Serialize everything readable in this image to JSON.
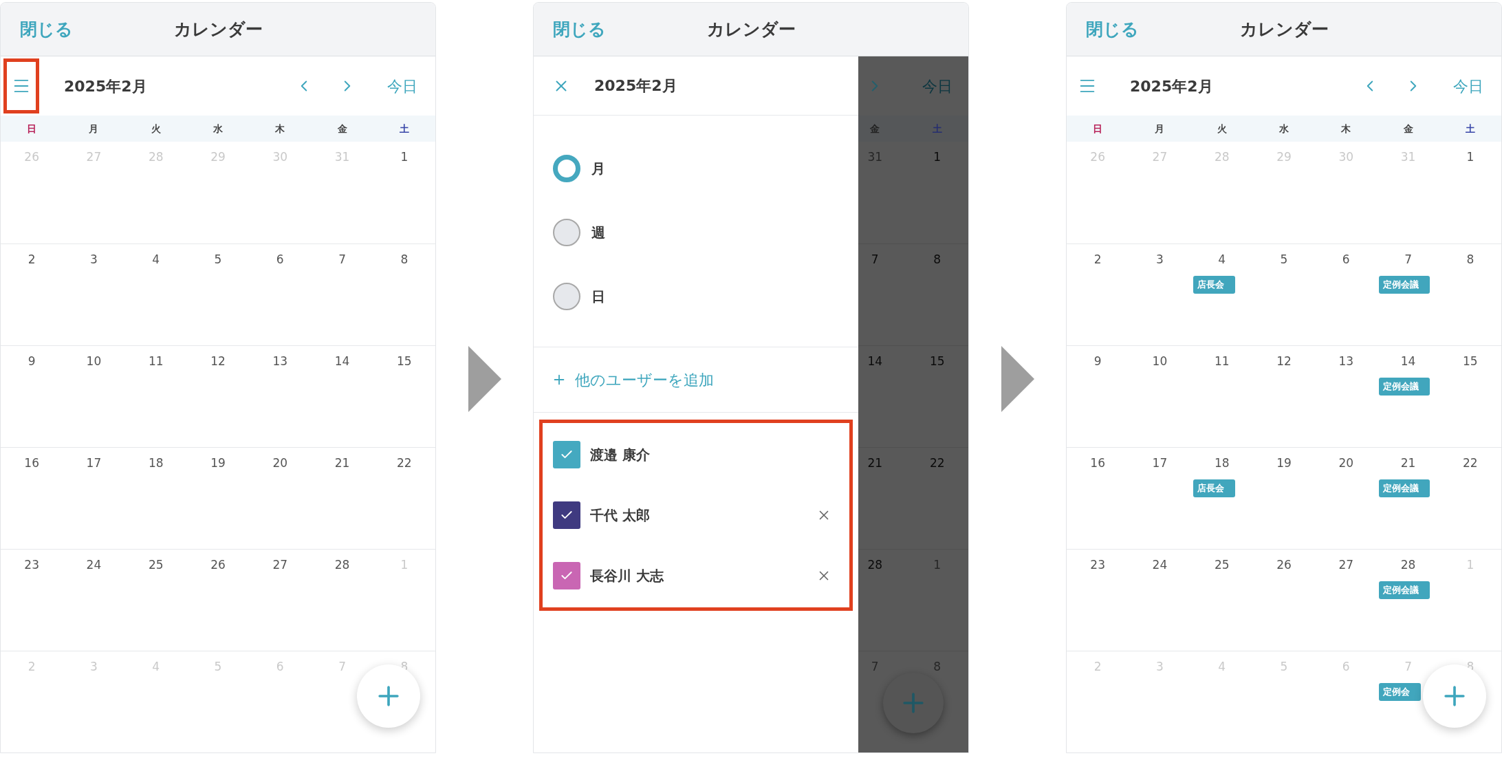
{
  "screens": [
    {
      "kind": "calendar",
      "header": {
        "close": "閉じる",
        "title": "カレンダー"
      },
      "toolbar": {
        "menu_highlighted": true,
        "month": "2025年2月",
        "today": "今日"
      },
      "weekdays": [
        {
          "label": "日",
          "color": "#b8245a"
        },
        {
          "label": "月",
          "color": "#444444"
        },
        {
          "label": "火",
          "color": "#444444"
        },
        {
          "label": "水",
          "color": "#444444"
        },
        {
          "label": "木",
          "color": "#444444"
        },
        {
          "label": "金",
          "color": "#444444"
        },
        {
          "label": "土",
          "color": "#3846a8"
        }
      ],
      "weeks": [
        [
          {
            "day": "26",
            "muted": true
          },
          {
            "day": "27",
            "muted": true
          },
          {
            "day": "28",
            "muted": true
          },
          {
            "day": "29",
            "muted": true
          },
          {
            "day": "30",
            "muted": true
          },
          {
            "day": "31",
            "muted": true
          },
          {
            "day": "1",
            "muted": false
          }
        ],
        [
          {
            "day": "2",
            "muted": false
          },
          {
            "day": "3",
            "muted": false
          },
          {
            "day": "4",
            "muted": false
          },
          {
            "day": "5",
            "muted": false
          },
          {
            "day": "6",
            "muted": false
          },
          {
            "day": "7",
            "muted": false
          },
          {
            "day": "8",
            "muted": false
          }
        ],
        [
          {
            "day": "9",
            "muted": false
          },
          {
            "day": "10",
            "muted": false
          },
          {
            "day": "11",
            "muted": false
          },
          {
            "day": "12",
            "muted": false
          },
          {
            "day": "13",
            "muted": false
          },
          {
            "day": "14",
            "muted": false
          },
          {
            "day": "15",
            "muted": false
          }
        ],
        [
          {
            "day": "16",
            "muted": false
          },
          {
            "day": "17",
            "muted": false
          },
          {
            "day": "18",
            "muted": false
          },
          {
            "day": "19",
            "muted": false
          },
          {
            "day": "20",
            "muted": false
          },
          {
            "day": "21",
            "muted": false
          },
          {
            "day": "22",
            "muted": false
          }
        ],
        [
          {
            "day": "23",
            "muted": false
          },
          {
            "day": "24",
            "muted": false
          },
          {
            "day": "25",
            "muted": false
          },
          {
            "day": "26",
            "muted": false
          },
          {
            "day": "27",
            "muted": false
          },
          {
            "day": "28",
            "muted": false
          },
          {
            "day": "1",
            "muted": true
          }
        ],
        [
          {
            "day": "2",
            "muted": true
          },
          {
            "day": "3",
            "muted": true
          },
          {
            "day": "4",
            "muted": true
          },
          {
            "day": "5",
            "muted": true
          },
          {
            "day": "6",
            "muted": true
          },
          {
            "day": "7",
            "muted": true
          },
          {
            "day": "8",
            "muted": true
          }
        ]
      ]
    },
    {
      "kind": "drawer",
      "header": {
        "close": "閉じる",
        "title": "カレンダー"
      },
      "toolbar": {
        "month": "2025年2月"
      },
      "view_options": [
        {
          "label": "月",
          "selected": true
        },
        {
          "label": "週",
          "selected": false
        },
        {
          "label": "日",
          "selected": false
        }
      ],
      "add_user": "他のユーザーを追加",
      "users_highlighted": true,
      "users": [
        {
          "name": "渡邉 康介",
          "checked": true,
          "color": "#44a9c0",
          "removable": false
        },
        {
          "name": "千代 太郎",
          "checked": true,
          "color": "#3f3a80",
          "removable": true
        },
        {
          "name": "長谷川 大志",
          "checked": true,
          "color": "#c966b3",
          "removable": true
        }
      ],
      "background": {
        "today": "今日",
        "weekdays": [
          {
            "label": "金",
            "color": "#222222"
          },
          {
            "label": "土",
            "color": "#262e70"
          }
        ],
        "weeks": [
          [
            {
              "day": "31",
              "muted": true
            },
            {
              "day": "1",
              "muted": false
            }
          ],
          [
            {
              "day": "7",
              "muted": false
            },
            {
              "day": "8",
              "muted": false
            }
          ],
          [
            {
              "day": "14",
              "muted": false
            },
            {
              "day": "15",
              "muted": false
            }
          ],
          [
            {
              "day": "21",
              "muted": false
            },
            {
              "day": "22",
              "muted": false
            }
          ],
          [
            {
              "day": "28",
              "muted": false
            },
            {
              "day": "1",
              "muted": true
            }
          ],
          [
            {
              "day": "7",
              "muted": true
            },
            {
              "day": "8",
              "muted": true
            }
          ]
        ]
      }
    },
    {
      "kind": "calendar",
      "header": {
        "close": "閉じる",
        "title": "カレンダー"
      },
      "toolbar": {
        "menu_highlighted": false,
        "month": "2025年2月",
        "today": "今日"
      },
      "weekdays": [
        {
          "label": "日",
          "color": "#b8245a"
        },
        {
          "label": "月",
          "color": "#444444"
        },
        {
          "label": "火",
          "color": "#444444"
        },
        {
          "label": "水",
          "color": "#444444"
        },
        {
          "label": "木",
          "color": "#444444"
        },
        {
          "label": "金",
          "color": "#444444"
        },
        {
          "label": "土",
          "color": "#3846a8"
        }
      ],
      "weeks": [
        [
          {
            "day": "26",
            "muted": true
          },
          {
            "day": "27",
            "muted": true
          },
          {
            "day": "28",
            "muted": true
          },
          {
            "day": "29",
            "muted": true
          },
          {
            "day": "30",
            "muted": true
          },
          {
            "day": "31",
            "muted": true
          },
          {
            "day": "1",
            "muted": false
          }
        ],
        [
          {
            "day": "2",
            "muted": false
          },
          {
            "day": "3",
            "muted": false
          },
          {
            "day": "4",
            "muted": false,
            "events": [
              "店長会"
            ]
          },
          {
            "day": "5",
            "muted": false
          },
          {
            "day": "6",
            "muted": false
          },
          {
            "day": "7",
            "muted": false,
            "events": [
              "定例会議"
            ]
          },
          {
            "day": "8",
            "muted": false
          }
        ],
        [
          {
            "day": "9",
            "muted": false
          },
          {
            "day": "10",
            "muted": false
          },
          {
            "day": "11",
            "muted": false
          },
          {
            "day": "12",
            "muted": false
          },
          {
            "day": "13",
            "muted": false
          },
          {
            "day": "14",
            "muted": false,
            "events": [
              "定例会議"
            ]
          },
          {
            "day": "15",
            "muted": false
          }
        ],
        [
          {
            "day": "16",
            "muted": false
          },
          {
            "day": "17",
            "muted": false
          },
          {
            "day": "18",
            "muted": false,
            "events": [
              "店長会"
            ]
          },
          {
            "day": "19",
            "muted": false
          },
          {
            "day": "20",
            "muted": false
          },
          {
            "day": "21",
            "muted": false,
            "events": [
              "定例会議"
            ]
          },
          {
            "day": "22",
            "muted": false
          }
        ],
        [
          {
            "day": "23",
            "muted": false
          },
          {
            "day": "24",
            "muted": false
          },
          {
            "day": "25",
            "muted": false
          },
          {
            "day": "26",
            "muted": false
          },
          {
            "day": "27",
            "muted": false
          },
          {
            "day": "28",
            "muted": false,
            "events": [
              "定例会議"
            ]
          },
          {
            "day": "1",
            "muted": true
          }
        ],
        [
          {
            "day": "2",
            "muted": true
          },
          {
            "day": "3",
            "muted": true
          },
          {
            "day": "4",
            "muted": true
          },
          {
            "day": "5",
            "muted": true
          },
          {
            "day": "6",
            "muted": true
          },
          {
            "day": "7",
            "muted": true,
            "events": [
              "定例会"
            ]
          },
          {
            "day": "8",
            "muted": true
          }
        ]
      ]
    }
  ]
}
